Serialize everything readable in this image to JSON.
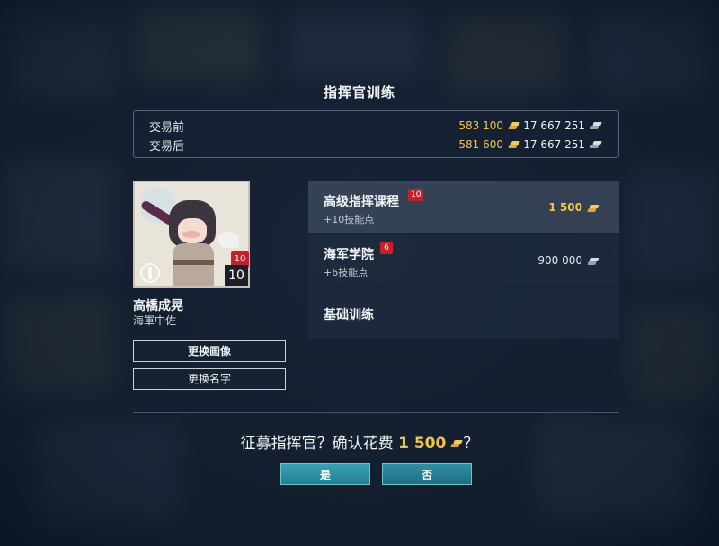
{
  "dialog": {
    "title": "指挥官训练"
  },
  "balance": {
    "before_label": "交易前",
    "before_gold": "583 100",
    "before_silver": "17 667 251",
    "after_label": "交易后",
    "after_gold": "581 600",
    "after_silver": "17 667 251",
    "gold_icon": "gold-bars-icon",
    "silver_icon": "silver-bars-icon"
  },
  "commander": {
    "level_badge": "10",
    "level": "10",
    "name": "高橋成晃",
    "rank": "海軍中佐",
    "change_portrait": "更换画像",
    "change_name": "更换名字"
  },
  "options": [
    {
      "name": "高级指挥课程",
      "tag": "10",
      "sub": "+10技能点",
      "price": "1 500",
      "currency": "gold",
      "selected": true
    },
    {
      "name": "海军学院",
      "tag": "6",
      "sub": "+6技能点",
      "price": "900 000",
      "currency": "silver",
      "selected": false
    },
    {
      "name": "基础训练"
    }
  ],
  "confirm": {
    "prefix": "征募指挥官？确认花费",
    "amount": "1 500",
    "suffix": "？",
    "yes": "是",
    "no": "否"
  },
  "colors": {
    "gold": "#f0c64a",
    "badge_red": "#c71f2d",
    "button_teal": "#2b8ea1"
  }
}
